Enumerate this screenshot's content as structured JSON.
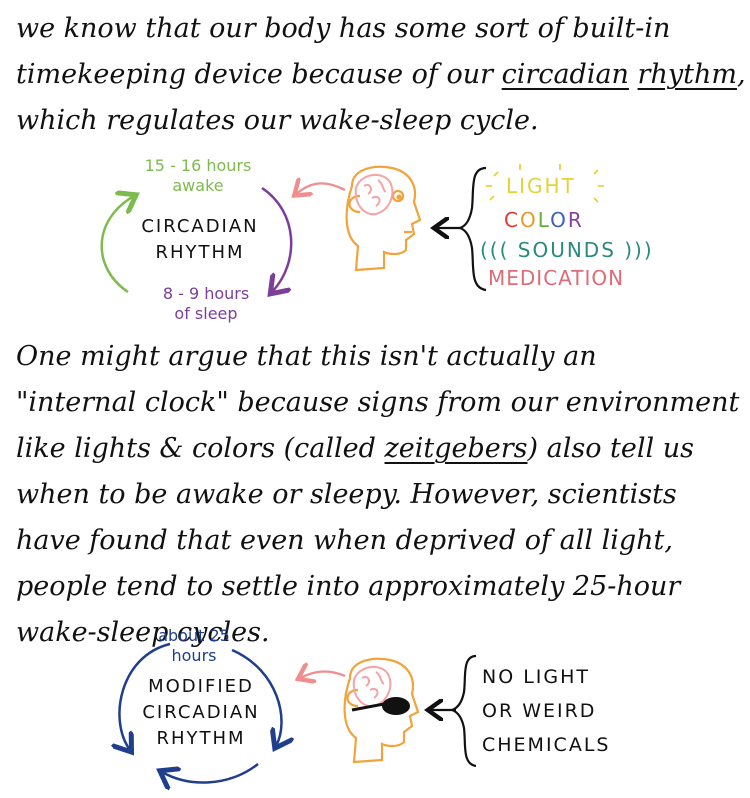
{
  "paragraph1": {
    "line1": "we know that our body has some sort of built-in",
    "line2_pre": "timekeeping device because of our ",
    "line2_term1": "circadian",
    "line2_space": " ",
    "line2_term2": "rhythm",
    "line2_post": ",",
    "line3": "which regulates our wake-sleep cycle."
  },
  "diagram1": {
    "cycle_label_line1": "CIRCADIAN",
    "cycle_label_line2": "RHYTHM",
    "awake_label_line1": "15 - 16 hours",
    "awake_label_line2": "awake",
    "sleep_label_line1": "8 - 9 hours",
    "sleep_label_line2": "of sleep",
    "cues": {
      "light": "LIGHT",
      "color": "COLOR",
      "sounds": "((( SOUNDS )))",
      "medication": "MEDICATION"
    },
    "colors": {
      "awake": "#7dbb4f",
      "sleep": "#7b3f9a",
      "light": "#e3d33a",
      "color_c": "#e03a2f",
      "color_o1": "#e59a2c",
      "color_l": "#6aae3c",
      "color_o2": "#3a62b5",
      "color_r": "#8a3fa0",
      "sounds": "#2b8a7e",
      "medication": "#e06b78",
      "head": "#f2a33a",
      "brain": "#f4a4a4"
    }
  },
  "paragraph2": {
    "line1": "One might argue that this isn't actually an",
    "line2": "\"internal clock\" because signs from our environment",
    "line3_pre": "like lights & colors  (called ",
    "line3_term": "zeitgebers",
    "line3_post": ") also tell us",
    "line4": "when to be awake or sleepy. However, scientists",
    "line5": "have found that even when deprived of all light,",
    "line6": "people tend to settle into approximately 25-hour",
    "line7": "wake-sleep cycles."
  },
  "diagram2": {
    "cycle_label_line1": "MODIFIED",
    "cycle_label_line2": "CIRCADIAN",
    "cycle_label_line3": "RHYTHM",
    "top_label_line1": "about 25",
    "top_label_line2": "hours",
    "cue_line1": "NO LIGHT",
    "cue_line2": "OR WEIRD",
    "cue_line3": "CHEMICALS",
    "colors": {
      "cycle": "#1f3e8c",
      "head": "#f2a33a",
      "brain": "#f4a4a4",
      "glasses": "#111111"
    }
  }
}
